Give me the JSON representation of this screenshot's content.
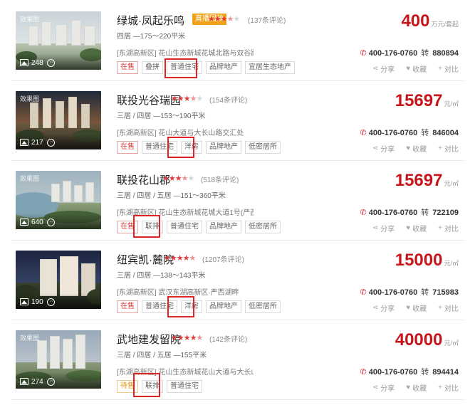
{
  "listings": [
    {
      "thumb_label": "效果图",
      "photo_count": "248",
      "name": "绿城·凤起乐鸣",
      "live_badge": "直播回放",
      "rating_stars": 3.5,
      "reviews": "(137条评论)",
      "layout": "四居 —175～220平米",
      "address": "[东湖高新区] 花山生态新城花城北路与双谷路的...",
      "tags": [
        "在售",
        "叠拼",
        "普通住宅",
        "品牌地产",
        "宜居生态地产"
      ],
      "price_value": "400",
      "price_unit": "万元/套起",
      "phone": "400-176-0760",
      "ext_sep": "转",
      "ext": "880894",
      "share": "分享",
      "favorite": "收藏",
      "compare": "对比"
    },
    {
      "thumb_label": "效果图",
      "photo_count": "217",
      "name": "联投光谷瑞园",
      "live_badge": "",
      "rating_stars": 3.5,
      "reviews": "(154条评论)",
      "layout": "三居 / 四居 —153～190平米",
      "address": "[东湖高新区] 花山大道与大长山路交汇处",
      "tags": [
        "在售",
        "普通住宅",
        "洋房",
        "品牌地产",
        "低密居所"
      ],
      "price_value": "15697",
      "price_unit": "元/㎡",
      "phone": "400-176-0760",
      "ext_sep": "转",
      "ext": "846004",
      "share": "分享",
      "favorite": "收藏",
      "compare": "对比"
    },
    {
      "thumb_label": "效果图",
      "photo_count": "640",
      "name": "联投花山郡",
      "live_badge": "",
      "rating_stars": 3.5,
      "reviews": "(518条评论)",
      "layout": "三居 / 四居 / 五居 —151～360平米",
      "address": "[东湖高新区] 花山生态新城花城大道1号(严西湖...",
      "tags": [
        "在售",
        "联排",
        "普通住宅",
        "品牌地产",
        "低密居所"
      ],
      "price_value": "15697",
      "price_unit": "元/㎡",
      "phone": "400-176-0760",
      "ext_sep": "转",
      "ext": "722109",
      "share": "分享",
      "favorite": "收藏",
      "compare": "对比"
    },
    {
      "thumb_label": "",
      "photo_count": "190",
      "name": "纽宾凯·麓院",
      "live_badge": "",
      "rating_stars": 4.5,
      "reviews": "(1207条评论)",
      "layout": "三居 / 四居 —138～143平米",
      "address": "[东湖高新区] 武汉东湖高新区·严西湖畔",
      "tags": [
        "在售",
        "普通住宅",
        "洋房",
        "品牌地产",
        "低密居所"
      ],
      "price_value": "15000",
      "price_unit": "元/㎡",
      "phone": "400-176-0760",
      "ext_sep": "转",
      "ext": "715983",
      "share": "分享",
      "favorite": "收藏",
      "compare": "对比"
    },
    {
      "thumb_label": "效果图",
      "photo_count": "274",
      "name": "武地建发留院",
      "live_badge": "",
      "rating_stars": 4.5,
      "reviews": "(142条评论)",
      "layout": "三居 / 四居 / 五居 —155平米",
      "address": "[东湖高新区] 花山生态新城花山大道与大长山路...",
      "tags": [
        "待售",
        "联排",
        "普通住宅"
      ],
      "price_value": "40000",
      "price_unit": "元/㎡",
      "phone": "400-176-0760",
      "ext_sep": "转",
      "ext": "894414",
      "share": "分享",
      "favorite": "收藏",
      "compare": "对比"
    }
  ],
  "colors": {
    "price": "#c8151b",
    "status_on_sale": "#e13b3b",
    "status_pending": "#e49a1a",
    "live_badge": "#f0a31a",
    "highlight_box": "#e02424"
  }
}
